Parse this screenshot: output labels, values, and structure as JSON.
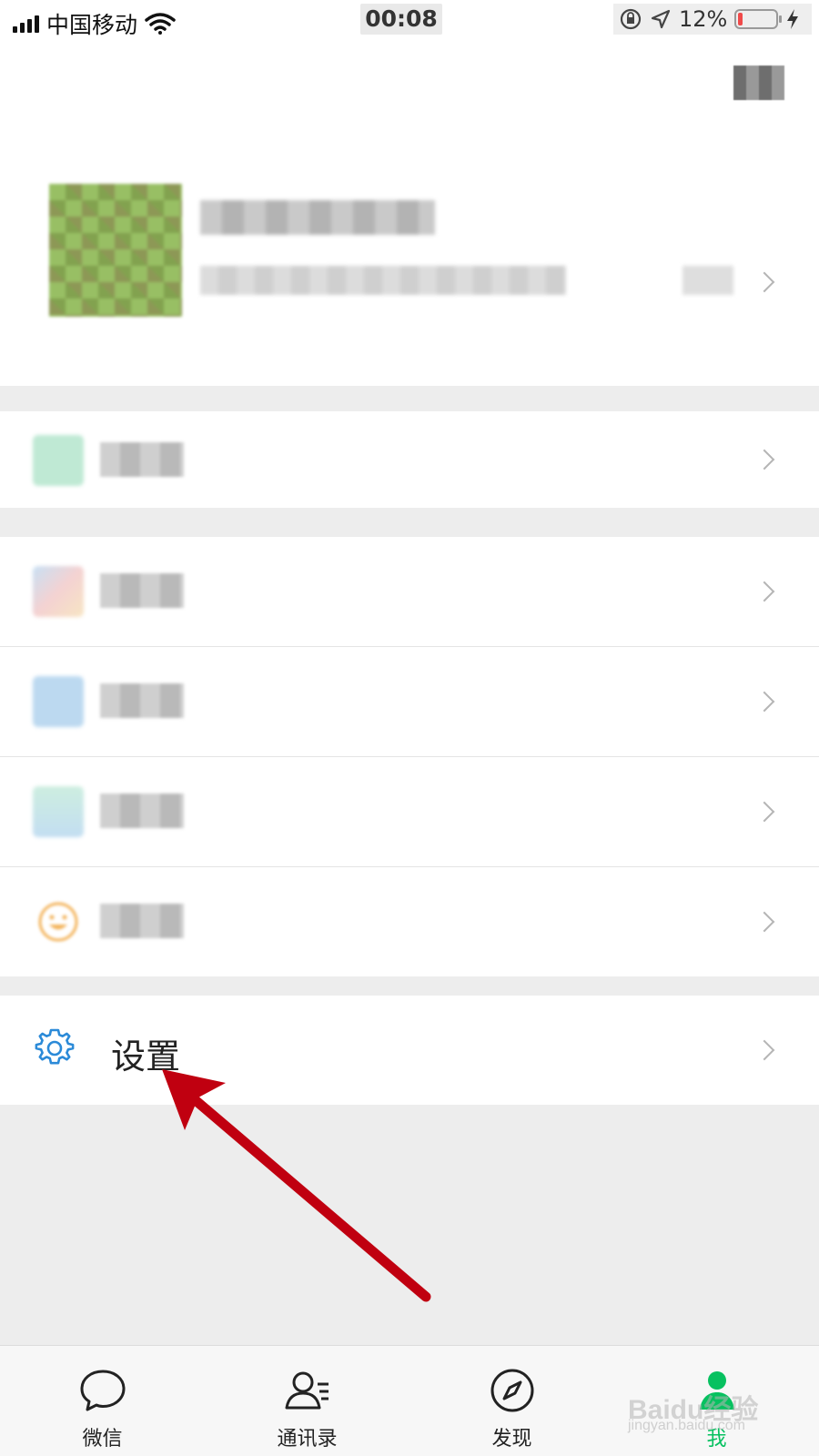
{
  "status_bar": {
    "carrier": "中国移动",
    "time": "00:08",
    "battery_percent": "12%",
    "battery_level": 0.12
  },
  "menu": {
    "settings_label": "设置"
  },
  "tabbar": {
    "tabs": [
      {
        "label": "微信",
        "icon": "chat-bubble-icon",
        "active": false
      },
      {
        "label": "通讯录",
        "icon": "contacts-icon",
        "active": false
      },
      {
        "label": "发现",
        "icon": "compass-icon",
        "active": false
      },
      {
        "label": "我",
        "icon": "me-icon",
        "active": true
      }
    ]
  },
  "watermark": {
    "brand": "Baidu经验",
    "url": "jingyan.baidu.com"
  },
  "colors": {
    "accent_green": "#07c160",
    "annotation_arrow": "#c00010",
    "settings_icon_blue": "#2b8ad8",
    "battery_low": "#f04a4a"
  }
}
